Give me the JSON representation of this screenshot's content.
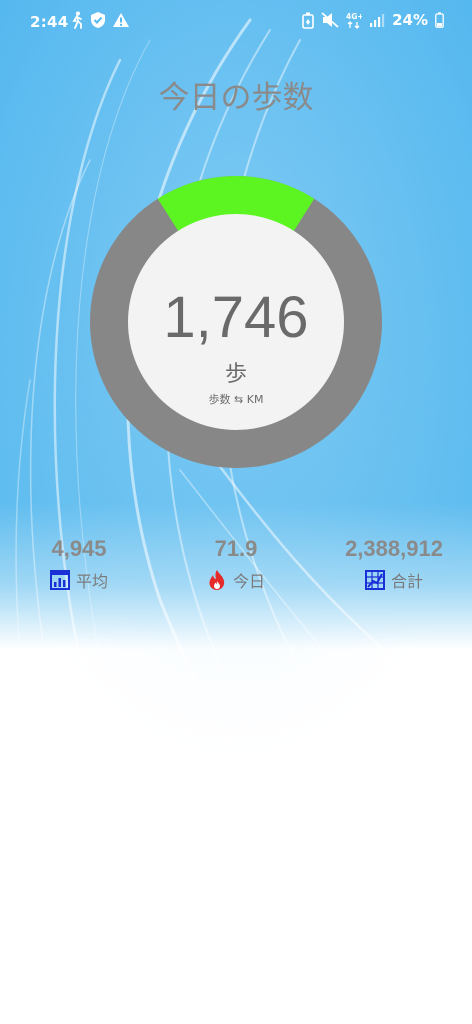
{
  "status_bar": {
    "time": "2:44",
    "battery": "24%",
    "icons": [
      "walk-icon",
      "shield-check-icon",
      "warning-icon",
      "battery-saver-icon",
      "mute-icon",
      "data-4g-icon",
      "signal-icon",
      "battery-icon"
    ]
  },
  "page": {
    "title": "今日の歩数"
  },
  "gauge": {
    "steps": "1,746",
    "unit": "歩",
    "toggle_label": "歩数 ⇆ KM",
    "progress_fraction": 0.18,
    "progress_color": "#5cf522",
    "track_color": "#878787",
    "center_color": "#f3f3f3"
  },
  "stats": [
    {
      "value": "4,945",
      "label": "平均",
      "icon": "average-chart-icon",
      "icon_color": "#1a2fd6"
    },
    {
      "value": "71.9",
      "label": "今日",
      "icon": "flame-icon",
      "icon_color": "#e52a2a"
    },
    {
      "value": "2,388,912",
      "label": "合計",
      "icon": "total-grid-icon",
      "icon_color": "#1a2fd6"
    }
  ],
  "colors": {
    "background_top": "#55b8ef",
    "background_bottom": "#ffffff"
  }
}
